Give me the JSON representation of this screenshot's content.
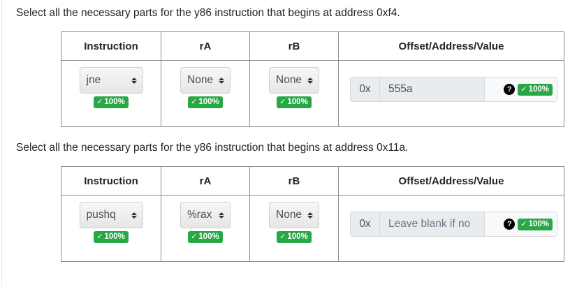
{
  "questions": [
    {
      "prompt": "Select all the necessary parts for the y86 instruction that begins at address 0xf4.",
      "headers": {
        "instruction": "Instruction",
        "ra": "rA",
        "rb": "rB",
        "offset": "Offset/Address/Value"
      },
      "instruction": {
        "value": "jne",
        "score": "100%"
      },
      "ra": {
        "value": "None",
        "score": "100%"
      },
      "rb": {
        "value": "None",
        "score": "100%"
      },
      "offset": {
        "prefix": "0x",
        "value": "555a",
        "placeholder": "",
        "help": "?",
        "score": "100%"
      }
    },
    {
      "prompt": "Select all the necessary parts for the y86 instruction that begins at address 0x11a.",
      "headers": {
        "instruction": "Instruction",
        "ra": "rA",
        "rb": "rB",
        "offset": "Offset/Address/Value"
      },
      "instruction": {
        "value": "pushq",
        "score": "100%"
      },
      "ra": {
        "value": "%rax",
        "score": "100%"
      },
      "rb": {
        "value": "None",
        "score": "100%"
      },
      "offset": {
        "prefix": "0x",
        "value": "",
        "placeholder": "Leave blank if no",
        "help": "?",
        "score": "100%"
      }
    }
  ],
  "icons": {
    "check": "check-mark-icon",
    "help": "question-circle-icon",
    "select_arrows": "up-down-arrows-icon"
  },
  "colors": {
    "success": "#28a745",
    "border": "#8e8e8e",
    "text": "#212529"
  }
}
